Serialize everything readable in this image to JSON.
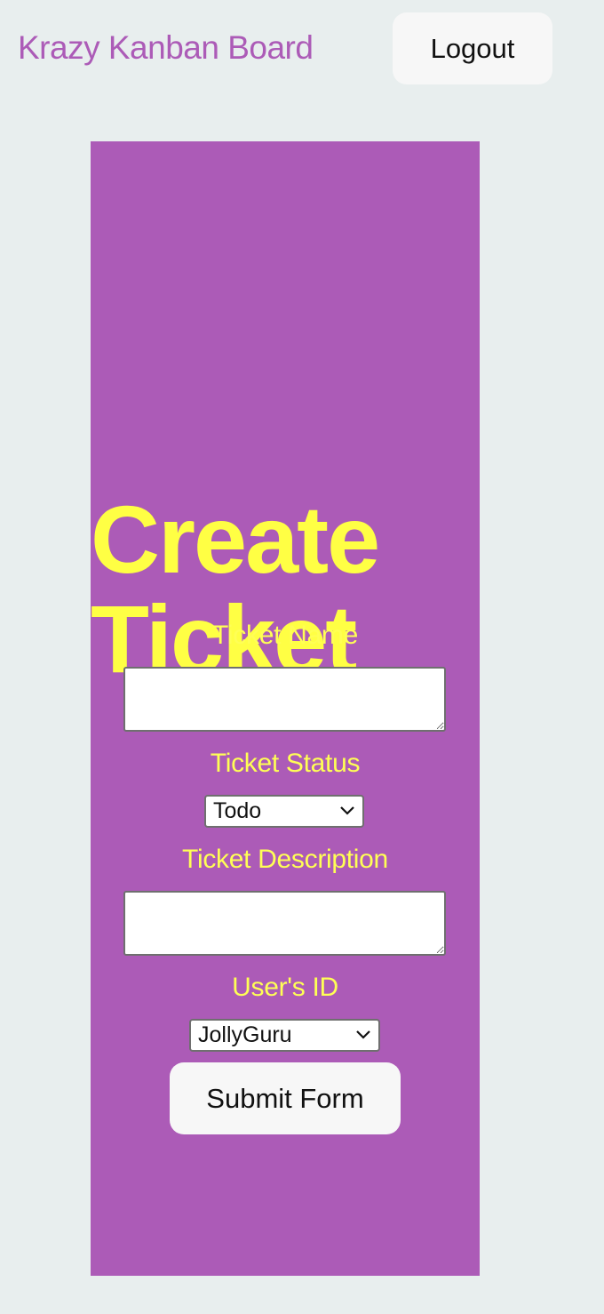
{
  "navbar": {
    "brand": "Krazy Kanban Board",
    "logout_label": "Logout"
  },
  "form": {
    "title": "Create Ticket",
    "name_label": "Ticket Name",
    "name_value": "",
    "status_label": "Ticket Status",
    "status_selected": "Todo",
    "description_label": "Ticket Description",
    "description_value": "",
    "user_label": "User's ID",
    "user_selected": "JollyGuru",
    "submit_label": "Submit Form"
  },
  "colors": {
    "page_background": "#e8eeee",
    "panel_background": "#ac5bb7",
    "accent_text": "#ffff44",
    "brand_text": "#ac5bb7",
    "button_background": "#f7f7f7"
  },
  "icons": {
    "select_arrow": "chevron-down-icon",
    "textarea_grip": "resize-handle-icon"
  }
}
